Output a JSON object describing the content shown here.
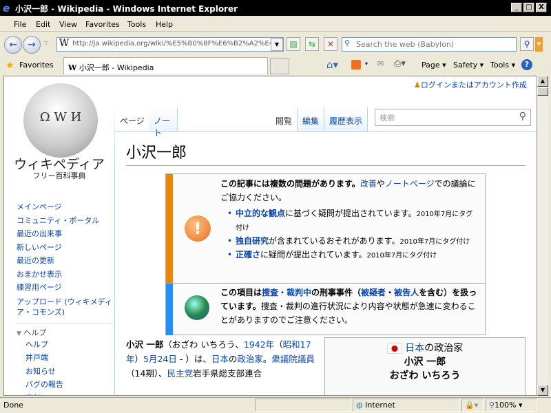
{
  "window": {
    "title": "小沢一郎 - Wikipedia - Windows Internet Explorer",
    "min": "_",
    "max": "□",
    "close": "X"
  },
  "menu": [
    "File",
    "Edit",
    "View",
    "Favorites",
    "Tools",
    "Help"
  ],
  "nav": {
    "address": "http://ja.wikipedia.org/wiki/%E5%B0%8F%E6%B2%A2%E4%B8%80%E9%83%8E",
    "search_placeholder": "Search the web (Babylon)"
  },
  "favbar": {
    "favorites": "Favorites",
    "tab_title": "小沢一郎 - Wikipedia",
    "page": "Page",
    "safety": "Safety",
    "tools": "Tools"
  },
  "wiki": {
    "logo_text": "ウィキペディア",
    "logo_sub": "フリー百科事典",
    "login": "ログインまたはアカウント作成",
    "sidebar": [
      "メインページ",
      "コミュニティ・ポータル",
      "最近の出来事",
      "新しいページ",
      "最近の更新",
      "おまかせ表示",
      "練習用ページ",
      "アップロード (ウィキメディア・コモンズ)"
    ],
    "help_heading": "ヘルプ",
    "help_items": [
      "ヘルプ",
      "井戸端",
      "お知らせ",
      "バグの報告",
      "寄付"
    ],
    "tabs": {
      "page": "ページ",
      "note": "ノート",
      "read": "閲覧",
      "edit": "編集",
      "history": "履歴表示"
    },
    "search_placeholder": "検索",
    "title": "小沢一郎",
    "mbox1": {
      "lead": "この記事には複数の問題があります。",
      "improve": "改善",
      "ya": "や",
      "talk": "ノートページ",
      "rest": "での議論にご協力ください。",
      "issues": [
        {
          "link": "中立的な観点",
          "text": "に基づく疑問が提出されています。",
          "date": "2010年7月にタグ付け"
        },
        {
          "link": "独自研究",
          "text": "が含まれているおそれがあります。",
          "date": "2010年7月にタグ付け"
        },
        {
          "link": "正確さ",
          "text": "に疑問が提出されています。",
          "date": "2010年7月にタグ付け"
        }
      ]
    },
    "mbox2": {
      "t1": "この項目は",
      "l1": "捜査・裁判中",
      "t2": "の刑事事件（",
      "l2": "被疑者",
      "t3": "・",
      "l3": "被告人",
      "t4": "を含む）を扱っています。",
      "t5": "捜査・裁判の進行状況により内容や状態が急速に変わることがありますのでご注意ください。"
    },
    "para": {
      "name": "小沢 一郎",
      "p1": "（おざわ いちろう、",
      "l_year": "1942年",
      "p2": "（",
      "l_showa": "昭和17年",
      "p3": "）",
      "l_date": "5月24日",
      "p4": " - ）は、",
      "l_japan": "日本",
      "p5": "の",
      "l_pol": "政治家",
      "p6": "。",
      "l_rep": "衆議院議員",
      "p7": "（14期）、",
      "l_dpj": "民主党",
      "p8": "岩手県総支部連合"
    },
    "infobox": {
      "country": "日本",
      "role": "の政治家",
      "name": "小沢 一郎",
      "kana": "おざわ いちろう"
    }
  },
  "status": {
    "text": "Done",
    "zone": "Internet",
    "zoom": "100%"
  }
}
